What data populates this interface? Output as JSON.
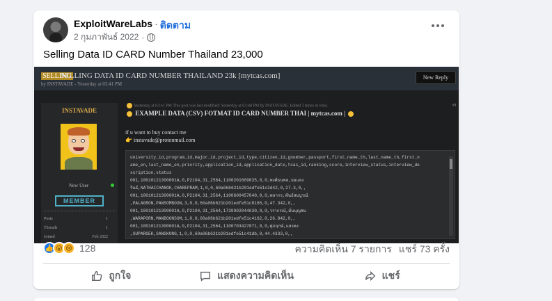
{
  "post": {
    "author": "ExploitWareLabs",
    "separator": "·",
    "follow_label": "ติดตาม",
    "date": "2 กุมภาพันธ์ 2022",
    "text": "Selling Data ID CARD Number Thailand 23,000"
  },
  "screenshot": {
    "badge": "SELLING",
    "title": "SELLING DATA ID CARD NUMBER THAILAND 23k [mytcas.com]",
    "byline": "by INSTAVADE - Yesterday at 03:41 PM",
    "new_reply": "New Reply",
    "user": {
      "name": "INSTAVADE",
      "rank": "New User",
      "badge": "MEMBER",
      "stats": [
        {
          "label": "Posts",
          "value": "1"
        },
        {
          "label": "Threads",
          "value": "1"
        },
        {
          "label": "Joined",
          "value": "Feb 2022"
        }
      ]
    },
    "post_meta": "Yesterday at 03:41 PM This post was last modified: Yesterday at 03:48 PM by INSTAVADE. Edited 3 times in total.",
    "post_number": "#1",
    "post_title": "EXAMPLE DATA (CSV) FOTMAT ID CARD NUMBER THAI | mytcas.com |",
    "post_line1": "if u want to buy contact me",
    "post_line2": "instavade@protonmail.com",
    "code_lines": [
      "university_id,program_id,major_id,project_id,type,citizen_id,gnumber,passport,first_name_th,last_name_th,first_n",
      "ame_en,last_name_en,priority,application_id,application_date,tcas_id,ranking,score,interview_status,interview_de",
      "scription,status",
      "001,10010121300001A,0,P2104,31_2564,1100201669835,0,0,พงศ์ธนพล,ยอแลง",
      "รินธ์,NATHAICHANOK,CHAREPRAM,1,0,0,60a06b621b201edfe51c2d42,0,27.3,0,,",
      "001,10010121300001A,0,P2104,31_2564,1100600457840,0,0,พลากร,พันธ์สมบูรณ์",
      ",PALAGRON,PANSOMBOON,3,0,0,60a06b621b201edfe51c8165,0,47.342,0,,",
      "001,10010121300001A,0,P2104,31_2564,1739902044630,0,0,วรากรณ์,มั่นบุญสม",
      ",WARAPORN,MANBOONSOM,1,0,0,60a06b621b201edfe51c4162,0,26.842,0,,",
      "001,10010121300001A,0,P2104,31_2564,1100703427871,0,0,ศุภฤกษ์,แสงคง",
      ",SUPARGEK,SANGKONG,1,0,0,60a06b621b201edfe51c41db,0,44.4333,0,,"
    ]
  },
  "reactions": {
    "count": "128",
    "comments": "ความคิดเห็น 7 รายการ",
    "shares": "แชร์ 73 ครั้ง"
  },
  "actions": {
    "like": "ถูกใจ",
    "comment": "แสดงความคิดเห็น",
    "share": "แชร์"
  }
}
